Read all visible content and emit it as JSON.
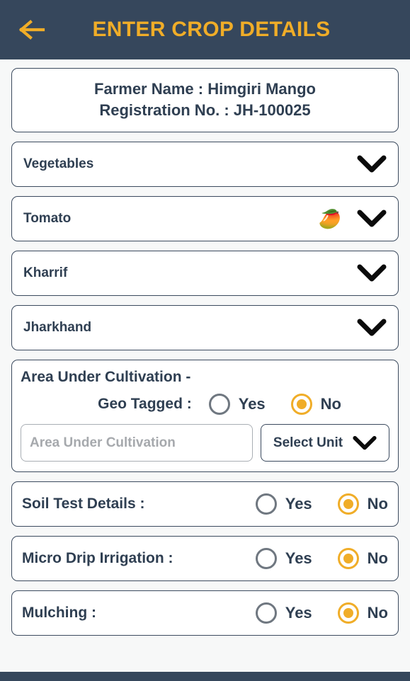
{
  "header": {
    "back_icon": "arrow-left-icon",
    "title": "ENTER CROP DETAILS",
    "bg_color": "#36475c",
    "accent_color": "#f0ad28"
  },
  "farmer": {
    "name_line": "Farmer Name : Himgiri Mango",
    "registration_line": "Registration No. : JH-100025"
  },
  "selects": [
    {
      "name": "crop-category",
      "value": "Vegetables",
      "emoji": "",
      "chevron_icon": "chevron-down-icon"
    },
    {
      "name": "crop-name",
      "value": "Tomato",
      "emoji": "🥭",
      "chevron_icon": "chevron-down-icon"
    },
    {
      "name": "season",
      "value": "Kharrif",
      "emoji": "",
      "chevron_icon": "chevron-down-icon"
    },
    {
      "name": "state",
      "value": "Jharkhand",
      "emoji": "",
      "chevron_icon": "chevron-down-icon"
    }
  ],
  "area_section": {
    "title": "Area Under Cultivation -",
    "geo_label": "Geo Tagged :",
    "geo_yes": "Yes",
    "geo_no": "No",
    "geo_selected": "No",
    "area_value": "",
    "area_placeholder": "Area Under Cultivation",
    "unit_label": "Select Unit",
    "unit_chevron_icon": "chevron-down-icon"
  },
  "questions": [
    {
      "name": "soil-test-details",
      "label": "Soil Test Details :",
      "yes": "Yes",
      "no": "No",
      "selected": "No"
    },
    {
      "name": "micro-drip-irrigation",
      "label": "Micro Drip Irrigation :",
      "yes": "Yes",
      "no": "No",
      "selected": "No"
    },
    {
      "name": "mulching",
      "label": "Mulching :",
      "yes": "Yes",
      "no": "No",
      "selected": "No"
    }
  ],
  "colors": {
    "navy": "#36475c",
    "amber": "#f0ad28",
    "text": "#2f3f52",
    "page_bg": "#f7f8f8"
  }
}
